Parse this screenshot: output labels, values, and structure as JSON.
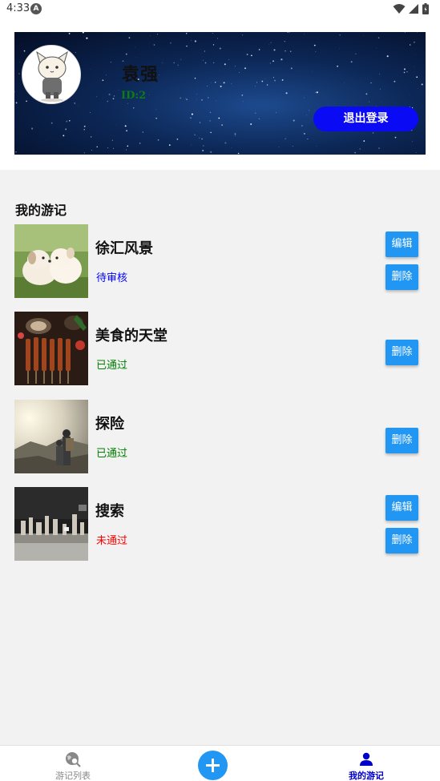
{
  "status_bar": {
    "time": "4:33",
    "app_icon": "A"
  },
  "profile": {
    "username": "袁强",
    "user_id": "ID:2",
    "logout_label": "退出登录"
  },
  "section_title": "我的游记",
  "colors": {
    "primary": "#2196f3",
    "logout": "#0a0af5",
    "pending": "#0000ff",
    "approved": "#008000",
    "rejected": "#ff0000",
    "nav_active": "#0000cc",
    "nav_inactive": "#888888"
  },
  "travelogues": [
    {
      "title": "徐汇风景",
      "status": "待审核",
      "status_color": "#0000ff",
      "thumbnail": "puppies",
      "actions": [
        "编辑",
        "删除"
      ]
    },
    {
      "title": "美食的天堂",
      "status": "已通过",
      "status_color": "#008000",
      "thumbnail": "bbq-food",
      "actions": [
        "删除"
      ]
    },
    {
      "title": "探险",
      "status": "已通过",
      "status_color": "#008000",
      "thumbnail": "hikers-mountain",
      "actions": [
        "删除"
      ]
    },
    {
      "title": "搜索",
      "status": "未通过",
      "status_color": "#ff0000",
      "thumbnail": "sculpture-exhibit",
      "actions": [
        "编辑",
        "删除"
      ]
    }
  ],
  "bottom_nav": {
    "items": [
      {
        "label": "游记列表",
        "icon": "globe-search-icon",
        "active": false
      },
      {
        "label": "",
        "icon": "plus-icon",
        "active": false
      },
      {
        "label": "我的游记",
        "icon": "person-icon",
        "active": true
      }
    ]
  }
}
